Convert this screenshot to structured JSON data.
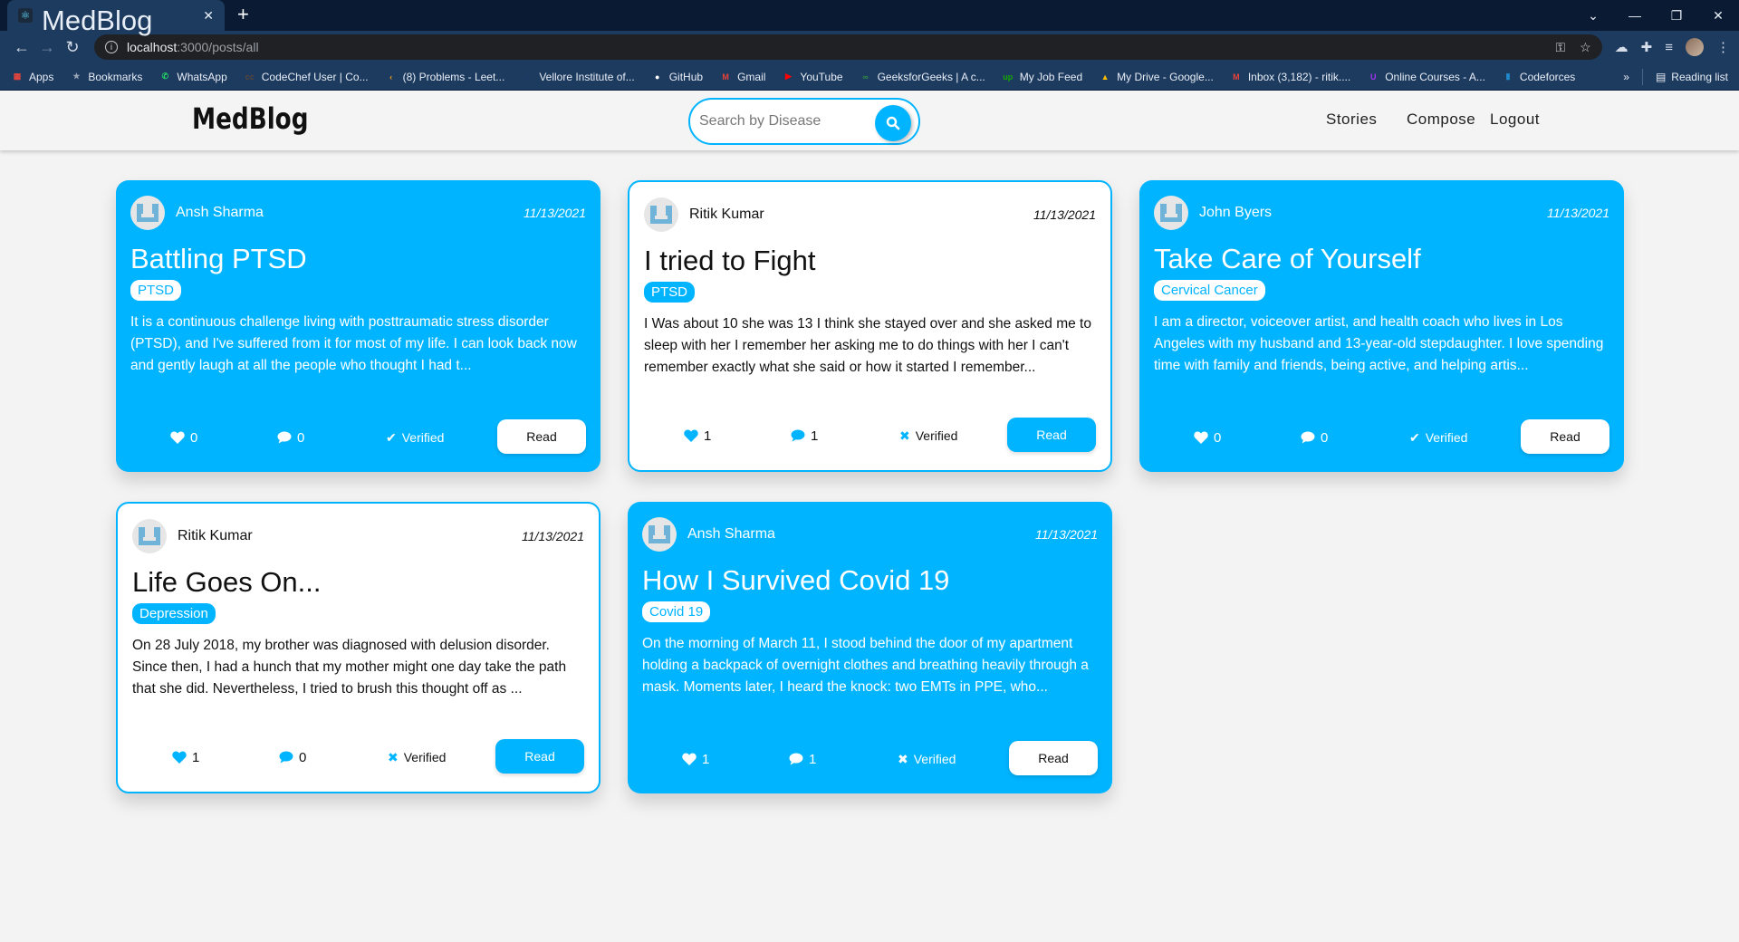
{
  "browser": {
    "tab_title": "MedBlog",
    "url_host": "localhost",
    "url_path": ":3000/posts/all",
    "bookmarks": [
      {
        "label": "Apps",
        "icon": "apps-grid-icon",
        "color": "#e8453c"
      },
      {
        "label": "Bookmarks",
        "icon": "star-icon",
        "color": "#9aa7b8"
      },
      {
        "label": "WhatsApp",
        "icon": "whatsapp-icon",
        "color": "#25d366"
      },
      {
        "label": "CodeChef User | Co...",
        "icon": "codechef-icon",
        "color": "#5b4638"
      },
      {
        "label": "(8) Problems - Leet...",
        "icon": "leetcode-icon",
        "color": "#f89f1b"
      },
      {
        "label": "Vellore Institute of...",
        "icon": "vit-icon",
        "color": "#1a3c8f"
      },
      {
        "label": "GitHub",
        "icon": "github-icon",
        "color": "#ffffff"
      },
      {
        "label": "Gmail",
        "icon": "gmail-icon",
        "color": "#ea4335"
      },
      {
        "label": "YouTube",
        "icon": "youtube-icon",
        "color": "#ff0000"
      },
      {
        "label": "GeeksforGeeks | A c...",
        "icon": "gfg-icon",
        "color": "#2f8d46"
      },
      {
        "label": "My Job Feed",
        "icon": "upwork-icon",
        "color": "#14a800"
      },
      {
        "label": "My Drive - Google...",
        "icon": "drive-icon",
        "color": "#fbbc04"
      },
      {
        "label": "Inbox (3,182) - ritik....",
        "icon": "gmail-icon",
        "color": "#ea4335"
      },
      {
        "label": "Online Courses - A...",
        "icon": "udemy-icon",
        "color": "#a435f0"
      },
      {
        "label": "Codeforces",
        "icon": "codeforces-icon",
        "color": "#1f8acb"
      }
    ],
    "overflow": "»",
    "reading_list": "Reading list"
  },
  "header": {
    "brand": "MedBlog",
    "search_placeholder": "Search by Disease",
    "nav": [
      "Stories",
      "Compose",
      "Logout"
    ]
  },
  "colors": {
    "accent": "#00b4ff",
    "page_bg": "#f3f3f3"
  },
  "posts": [
    {
      "author": "Ansh Sharma",
      "date": "11/13/2021",
      "title": "Battling PTSD",
      "tag": "PTSD",
      "excerpt": "It is a continuous challenge living with posttraumatic stress disorder (PTSD), and I've suffered from it for most of my life. I can look back now and gently laugh at all the people who thought I had t...",
      "likes": "0",
      "comments": "0",
      "verified": true,
      "verified_label": "Verified",
      "read_label": "Read",
      "style": "blue"
    },
    {
      "author": "Ritik Kumar",
      "date": "11/13/2021",
      "title": "I tried to Fight",
      "tag": "PTSD",
      "excerpt": "I Was about 10 she was 13 I think she stayed over and she asked me to sleep with her I remember her asking me to do things with her I can't remember exactly what she said or how it started I remember...",
      "likes": "1",
      "comments": "1",
      "verified": false,
      "verified_label": "Verified",
      "read_label": "Read",
      "style": "white"
    },
    {
      "author": "John Byers",
      "date": "11/13/2021",
      "title": "Take Care of Yourself",
      "tag": "Cervical Cancer",
      "excerpt": "I am a director, voiceover artist, and health coach who lives in Los Angeles with my husband and 13-year-old stepdaughter. I love spending time with family and friends, being active, and helping artis...",
      "likes": "0",
      "comments": "0",
      "verified": true,
      "verified_label": "Verified",
      "read_label": "Read",
      "style": "blue"
    },
    {
      "author": "Ritik Kumar",
      "date": "11/13/2021",
      "title": "Life Goes On...",
      "tag": "Depression",
      "excerpt": "On 28 July 2018, my brother was diagnosed with delusion disorder. Since then, I had a hunch that my mother might one day take the path that she did. Nevertheless, I tried to brush this thought off as ...",
      "likes": "1",
      "comments": "0",
      "verified": false,
      "verified_label": "Verified",
      "read_label": "Read",
      "style": "white"
    },
    {
      "author": "Ansh Sharma",
      "date": "11/13/2021",
      "title": "How I Survived Covid 19",
      "tag": "Covid 19",
      "excerpt": "On the morning of March 11, I stood behind the door of my apartment holding a backpack of overnight clothes and breathing heavily through a mask. Moments later, I heard the knock: two EMTs in PPE, who...",
      "likes": "1",
      "comments": "1",
      "verified": false,
      "verified_label": "Verified",
      "read_label": "Read",
      "style": "blue"
    }
  ]
}
